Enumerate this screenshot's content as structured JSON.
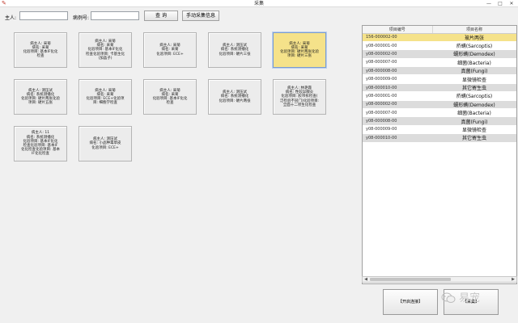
{
  "window": {
    "title": "采集",
    "min": "—",
    "max": "□",
    "close": "✕"
  },
  "toolbar": {
    "owner_label": "主人:",
    "owner_value": "",
    "case_label": "病例号:",
    "case_value": "",
    "query_label": "查 询",
    "manual_label": "手动采集信息"
  },
  "cards": [
    {
      "text": "病主人: 采菊\n病名: 采菊\n化验项目: 基本IF化化\n检查",
      "selected": false
    },
    {
      "text": "病主人: 采菊\n病名: 采菊\n化验项目: 基本IF化化\n检查化验项目: 卡基生化\n(加晶子)",
      "selected": false
    },
    {
      "text": "病主人: 采菊\n病名: 采菊\n化验项目: ECE+",
      "selected": false
    },
    {
      "text": "病主人: 测压试\n病名: 系统测播化\n化验项目: 硬片三张",
      "selected": false
    },
    {
      "text": "病主人: 采菊\n病名: 采菊\n化验项目: 硬片两张化验\n项目: 硬片三张",
      "selected": true
    },
    {
      "text": "病主人: 测压试\n病名: 系统测播化\n化验项目: 硬片两张化验\n项目: 硬片五张",
      "selected": false
    },
    {
      "text": "病主人: 采菊\n病名: 采菊\n化验项目: ECE+化验项\n目: 细胞学检查",
      "selected": false
    },
    {
      "text": "病主人: 采菊\n病名: 采菊\n化验项目: 基本IF化化\n检查",
      "selected": false
    },
    {
      "text": "病主人: 测压试\n病名: 系统测播化\n化验项目: 硬片两张",
      "selected": false
    },
    {
      "text": "病主人: 林艳霞\n病名: 性较异腺炎\n化验项目: 胶带拆检查(\n泛检验不同门)化验项目:\n全面十二项生化检查",
      "selected": false
    },
    {
      "text": "病主人: 11\n病名: 系统测播化\n化验项目: 基本IF化化\n检查化验项目: 基本IF\n化化检查化验项目: 基本\nIF化化检查",
      "selected": false
    },
    {
      "text": "病主人: 测压试\n病名: 小品种毒草皮\n化验项目: ECE+",
      "selected": false
    }
  ],
  "table": {
    "headers": [
      "项目编号",
      "项目名称"
    ],
    "rows": [
      {
        "code": "156-000002-00",
        "name": "玻片两张",
        "highlight": true
      },
      {
        "code": "y08-000001-00",
        "name": "疥螨(Sarcoptis)"
      },
      {
        "code": "y08-000002-00",
        "name": "蠕形螨(Demodex)"
      },
      {
        "code": "y08-000007-00",
        "name": "细菌(Bacteria)"
      },
      {
        "code": "y08-000008-00",
        "name": "真菌(Fungi)"
      },
      {
        "code": "y08-000009-00",
        "name": "显微镜检查"
      },
      {
        "code": "y08-000010-00",
        "name": "其它寄生虫"
      },
      {
        "code": "y08-000001-00",
        "name": "疥螨(Sarcoptis)"
      },
      {
        "code": "y08-000002-00",
        "name": "蠕形螨(Demodex)"
      },
      {
        "code": "y08-000007-00",
        "name": "细菌(Bacteria)"
      },
      {
        "code": "y08-000008-00",
        "name": "真菌(Fungi)"
      },
      {
        "code": "y08-000009-00",
        "name": "显微镜检查"
      },
      {
        "code": "y08-000010-00",
        "name": "其它寄生虫"
      }
    ]
  },
  "buttons": {
    "start_label": "【开启连接】",
    "collect_label": "【采集】"
  },
  "watermark": {
    "text": "易宠"
  },
  "colors": {
    "selected_card": "#f5e28a",
    "row_alt": "#dcdcdc",
    "title_icon": "#c0392b"
  }
}
